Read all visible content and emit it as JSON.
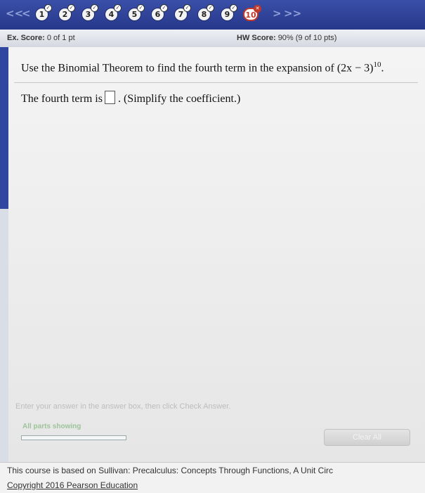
{
  "nav": {
    "first": "<<",
    "prev": "<",
    "next": ">",
    "last": ">>",
    "questions": [
      "1",
      "2",
      "3",
      "4",
      "5",
      "6",
      "7",
      "8",
      "9",
      "10"
    ],
    "current": "10"
  },
  "score": {
    "ex_label": "Ex. Score:",
    "ex_value": "0 of 1 pt",
    "hw_label": "HW Score:",
    "hw_value": "90% (9 of 10 pts)"
  },
  "question": {
    "text": "Use the Binomial Theorem to find the fourth term in the expansion of (2x − 3)",
    "exponent": "10",
    "end": "."
  },
  "answer": {
    "prefix": "The fourth term is",
    "suffix": ". (Simplify the coefficient.)"
  },
  "bottom": {
    "instruction": "Enter your answer in the answer box, then click Check Answer.",
    "all_parts": "All parts showing",
    "clear_all": "Clear All"
  },
  "footer": {
    "line1": "This course is based on Sullivan: Precalculus: Concepts Through Functions, A Unit Circ",
    "line2": "Copyright 2016 Pearson Education"
  }
}
